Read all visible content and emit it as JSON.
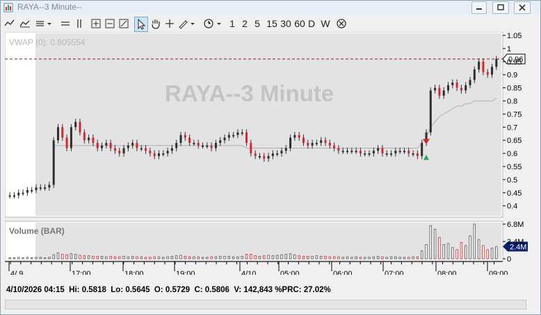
{
  "window": {
    "title": "RAYA--3 Minute--"
  },
  "toolbar": {
    "periods": [
      "1",
      "2",
      "5",
      "15",
      "30",
      "60",
      "D",
      "W"
    ]
  },
  "price_pane": {
    "indicator_label": "VWAP (0): 0.805554",
    "watermark": "RAYA--3 Minute",
    "y_ticks": [
      "1.05",
      "1",
      "0.95",
      "0.9",
      "0.85",
      "0.8",
      "0.75",
      "0.7",
      "0.65",
      "0.6",
      "0.55",
      "0.5",
      "0.45",
      "0.4"
    ],
    "last_price_tag": "0.96"
  },
  "volume_pane": {
    "label": "Volume (BAR)",
    "y_ticks": [
      "6.8M",
      "3.4M",
      "0"
    ],
    "last_volume_tag": "2.4M"
  },
  "time_axis": {
    "labels": [
      "4/ 9",
      "17:00",
      "18:00",
      "19:00",
      "4/10",
      "05:00",
      "06:00",
      "07:00",
      "08:00",
      "09:00"
    ]
  },
  "status_bar": {
    "date_time": "4/10/2026 04:15",
    "hi": "Hi: 0.5818",
    "lo": "Lo: 0.5645",
    "open": "O: 0.5729",
    "close": "C: 0.5806",
    "volume": "V: 142,843",
    "prc": "%PRC: 27.02%"
  },
  "chart_data": {
    "type": "candlestick",
    "price_ylim": [
      0.37,
      1.05
    ],
    "price_series": [
      0.44,
      0.44,
      0.45,
      0.45,
      0.46,
      0.46,
      0.47,
      0.47,
      0.47,
      0.48,
      0.65,
      0.7,
      0.66,
      0.62,
      0.7,
      0.72,
      0.68,
      0.65,
      0.66,
      0.64,
      0.62,
      0.63,
      0.64,
      0.62,
      0.61,
      0.6,
      0.62,
      0.63,
      0.64,
      0.62,
      0.62,
      0.61,
      0.6,
      0.59,
      0.6,
      0.6,
      0.61,
      0.62,
      0.64,
      0.67,
      0.66,
      0.64,
      0.64,
      0.63,
      0.63,
      0.63,
      0.62,
      0.64,
      0.65,
      0.66,
      0.67,
      0.67,
      0.68,
      0.68,
      0.64,
      0.6,
      0.59,
      0.59,
      0.58,
      0.59,
      0.6,
      0.6,
      0.61,
      0.62,
      0.66,
      0.67,
      0.66,
      0.64,
      0.63,
      0.64,
      0.64,
      0.65,
      0.64,
      0.63,
      0.62,
      0.61,
      0.61,
      0.61,
      0.61,
      0.61,
      0.6,
      0.6,
      0.6,
      0.61,
      0.62,
      0.6,
      0.6,
      0.6,
      0.61,
      0.61,
      0.61,
      0.6,
      0.6,
      0.59,
      0.64,
      0.68,
      0.84,
      0.85,
      0.82,
      0.84,
      0.86,
      0.87,
      0.85,
      0.84,
      0.86,
      0.88,
      0.92,
      0.95,
      0.91,
      0.9,
      0.93,
      0.96
    ],
    "vwap_series": [
      null,
      null,
      null,
      null,
      null,
      null,
      null,
      null,
      null,
      null,
      0.63,
      0.63,
      0.63,
      0.63,
      0.63,
      0.63,
      0.63,
      0.63,
      0.63,
      0.63,
      0.63,
      0.63,
      0.63,
      0.63,
      0.63,
      0.63,
      0.63,
      0.63,
      0.63,
      0.63,
      0.63,
      0.63,
      0.63,
      0.63,
      0.63,
      0.63,
      0.63,
      0.63,
      0.63,
      0.63,
      0.63,
      0.63,
      0.63,
      0.63,
      0.63,
      0.63,
      0.63,
      0.63,
      0.63,
      0.63,
      0.63,
      0.63,
      0.63,
      0.63,
      0.62,
      0.62,
      0.62,
      0.62,
      0.62,
      0.62,
      0.62,
      0.62,
      0.62,
      0.62,
      0.62,
      0.62,
      0.62,
      0.62,
      0.62,
      0.62,
      0.62,
      0.62,
      0.62,
      0.62,
      0.62,
      0.62,
      0.62,
      0.62,
      0.62,
      0.62,
      0.62,
      0.62,
      0.62,
      0.62,
      0.62,
      0.62,
      0.62,
      0.62,
      0.62,
      0.62,
      0.62,
      0.62,
      0.62,
      0.62,
      0.64,
      0.66,
      0.7,
      0.72,
      0.74,
      0.75,
      0.76,
      0.77,
      0.78,
      0.78,
      0.79,
      0.79,
      0.8,
      0.8,
      0.8,
      0.8,
      0.8,
      0.81
    ],
    "volume_ylim": [
      0,
      6.8
    ],
    "volume_series": [
      0.2,
      0.2,
      0.3,
      0.2,
      0.3,
      0.2,
      0.3,
      0.3,
      0.2,
      0.3,
      0.8,
      1.2,
      0.9,
      0.8,
      1.0,
      0.9,
      0.7,
      0.6,
      0.6,
      0.5,
      0.5,
      0.5,
      0.4,
      0.5,
      0.4,
      0.4,
      0.5,
      0.4,
      0.5,
      0.4,
      0.4,
      0.3,
      0.3,
      0.4,
      0.4,
      0.3,
      0.4,
      0.5,
      0.6,
      0.7,
      0.5,
      0.4,
      0.4,
      0.4,
      0.3,
      0.3,
      0.4,
      0.4,
      0.5,
      0.5,
      0.5,
      0.4,
      0.4,
      0.5,
      0.9,
      0.9,
      0.6,
      0.5,
      0.6,
      0.7,
      0.6,
      0.7,
      0.8,
      0.9,
      1.0,
      0.8,
      0.6,
      0.5,
      0.5,
      0.5,
      0.6,
      0.5,
      0.5,
      0.4,
      0.4,
      0.4,
      0.3,
      0.4,
      0.3,
      0.4,
      0.3,
      0.3,
      0.3,
      0.4,
      0.5,
      0.4,
      0.3,
      0.4,
      0.4,
      0.3,
      0.3,
      0.3,
      0.4,
      0.4,
      1.6,
      2.8,
      6.5,
      5.8,
      4.2,
      2.8,
      3.0,
      2.2,
      1.8,
      3.2,
      2.6,
      4.5,
      6.8,
      3.8,
      2.6,
      1.8,
      2.1,
      2.4
    ]
  },
  "colors": {
    "up": "#2e2e2e",
    "down": "#d9262b",
    "bg": "#e3e3e3",
    "vwap": "#b0b0b0",
    "marker_up": "#2aa84a",
    "marker_down": "#d9262b"
  }
}
